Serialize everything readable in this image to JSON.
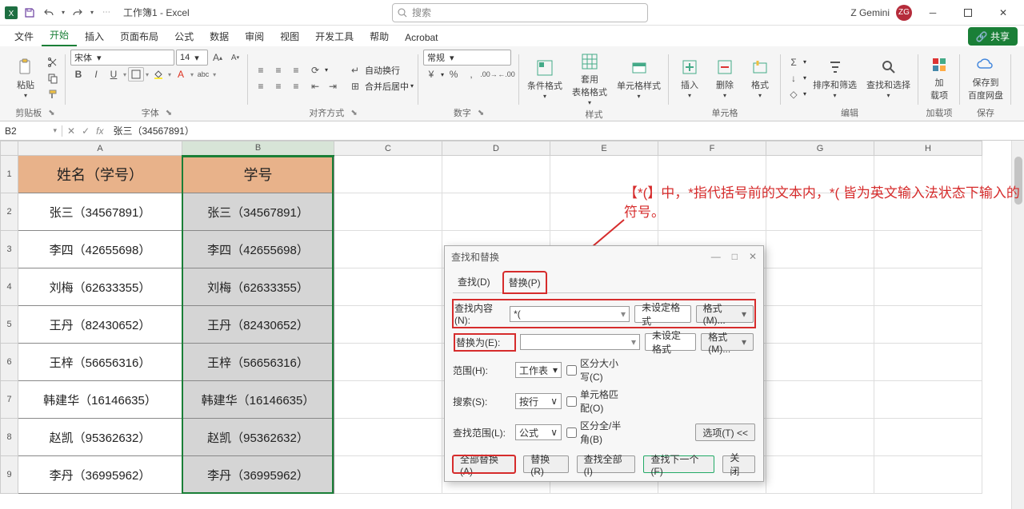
{
  "title": "工作簿1 - Excel",
  "search_placeholder": "搜索",
  "user": {
    "name": "Z Gemini",
    "initials": "ZG"
  },
  "menu": {
    "tabs": [
      "文件",
      "开始",
      "插入",
      "页面布局",
      "公式",
      "数据",
      "审阅",
      "视图",
      "开发工具",
      "帮助",
      "Acrobat"
    ],
    "active": 1,
    "share": "共享"
  },
  "ribbon": {
    "clipboard_label": "剪贴板",
    "paste": "粘贴",
    "font_label": "字体",
    "font_name": "宋体",
    "font_size": "14",
    "alignment_label": "对齐方式",
    "wrap": "自动换行",
    "merge": "合并后居中",
    "number_label": "数字",
    "number_format": "常规",
    "styles_label": "样式",
    "cond_fmt": "条件格式",
    "as_table": "套用\n表格格式",
    "cell_style": "单元格样式",
    "cells_label": "单元格",
    "insert": "插入",
    "delete": "删除",
    "format": "格式",
    "editing_label": "编辑",
    "sort_filter": "排序和筛选",
    "find_select": "查找和选择",
    "addins_label": "加载项",
    "addins": "加\n载项",
    "save_label": "保存",
    "save_to": "保存到\n百度网盘"
  },
  "formula_bar": {
    "cell_ref": "B2",
    "formula": "张三（34567891）"
  },
  "columns": [
    "A",
    "B",
    "C",
    "D",
    "E",
    "F",
    "G",
    "H"
  ],
  "grid": {
    "headers": [
      "姓名（学号）",
      "学号"
    ],
    "rows": [
      {
        "a": "张三（34567891）",
        "b": "张三（34567891）"
      },
      {
        "a": "李四（42655698）",
        "b": "李四（42655698）"
      },
      {
        "a": "刘梅（62633355）",
        "b": "刘梅（62633355）"
      },
      {
        "a": "王丹（82430652）",
        "b": "王丹（82430652）"
      },
      {
        "a": "王梓（56656316）",
        "b": "王梓（56656316）"
      },
      {
        "a": "韩建华（16146635）",
        "b": "韩建华（16146635）"
      },
      {
        "a": "赵凯（95362632）",
        "b": "赵凯（95362632）"
      },
      {
        "a": "李丹（36995962）",
        "b": "李丹（36995962）"
      }
    ]
  },
  "dialog": {
    "title": "查找和替换",
    "tab_find": "查找(D)",
    "tab_replace": "替换(P)",
    "find_label": "查找内容(N):",
    "find_value": "*(",
    "replace_label": "替换为(E):",
    "replace_value": "",
    "no_format": "未设定格式",
    "format_btn": "格式(M)...",
    "scope_label": "范围(H):",
    "scope_value": "工作表",
    "search_label": "搜索(S):",
    "search_value": "按行",
    "lookin_label": "查找范围(L):",
    "lookin_value": "公式",
    "match_case": "区分大小写(C)",
    "match_entire": "单元格匹配(O)",
    "match_width": "区分全/半角(B)",
    "options_btn": "选项(T) <<",
    "replace_all": "全部替换(A)",
    "replace_one": "替换(R)",
    "find_all": "查找全部(I)",
    "find_next": "查找下一个(F)",
    "close": "关闭"
  },
  "annotation": "【*(】中，*指代括号前的文本内，*( 皆为英文输入法状态下输入的符号。"
}
